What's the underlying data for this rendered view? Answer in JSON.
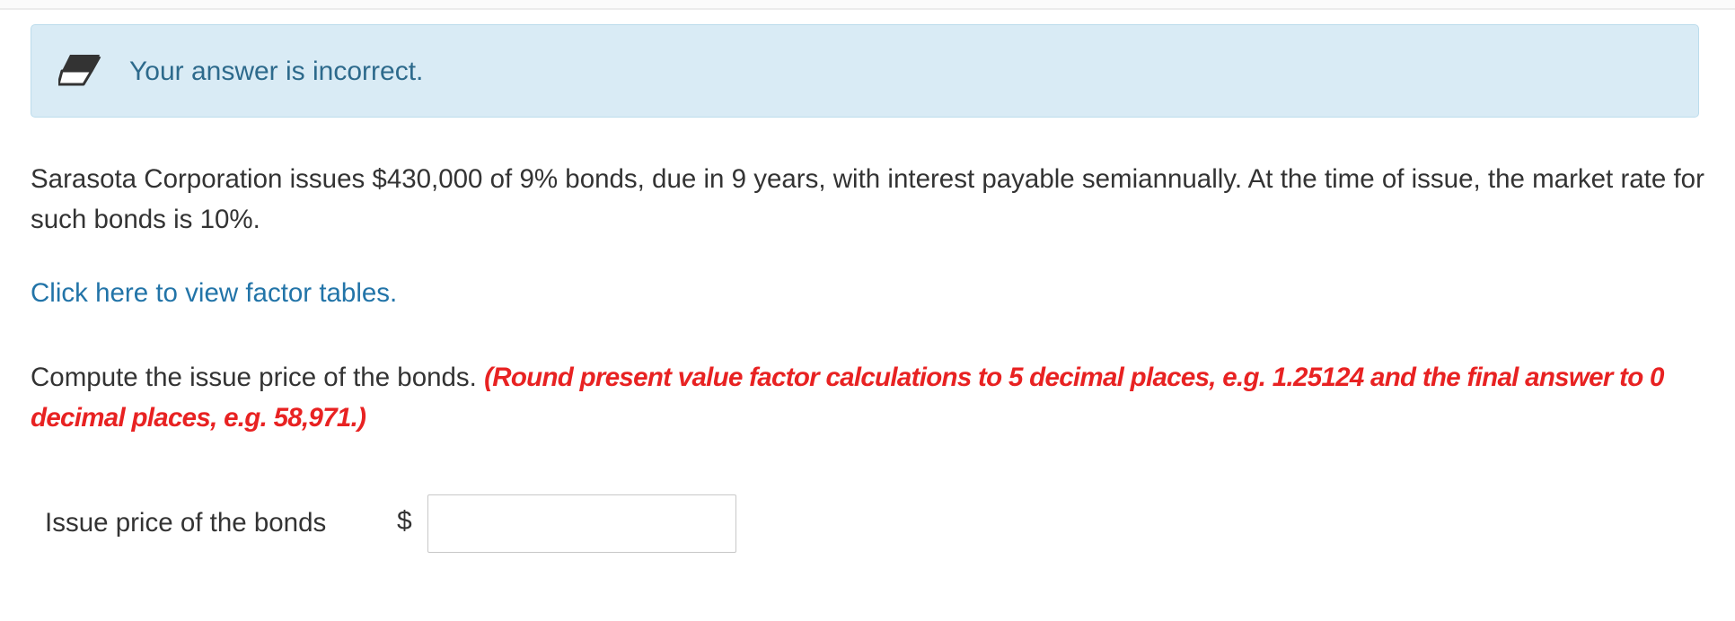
{
  "feedback": {
    "icon": "eraser-icon",
    "message": "Your answer is incorrect."
  },
  "problem": {
    "text": "Sarasota Corporation issues $430,000 of 9% bonds, due in 9 years, with interest payable semiannually. At the time of issue, the market rate for such bonds is 10%."
  },
  "factor_link": {
    "label": "Click here to view factor tables."
  },
  "instruction": {
    "text": "Compute the issue price of the bonds.",
    "hint": "(Round present value factor calculations to 5 decimal places, e.g. 1.25124 and the final answer to 0 decimal places, e.g. 58,971.)"
  },
  "answer": {
    "label": "Issue price of the bonds",
    "currency": "$",
    "value": ""
  },
  "colors": {
    "alert_background": "#d9ebf5",
    "alert_text": "#2d6a8c",
    "link": "#2274a8",
    "hint": "#e82222"
  }
}
